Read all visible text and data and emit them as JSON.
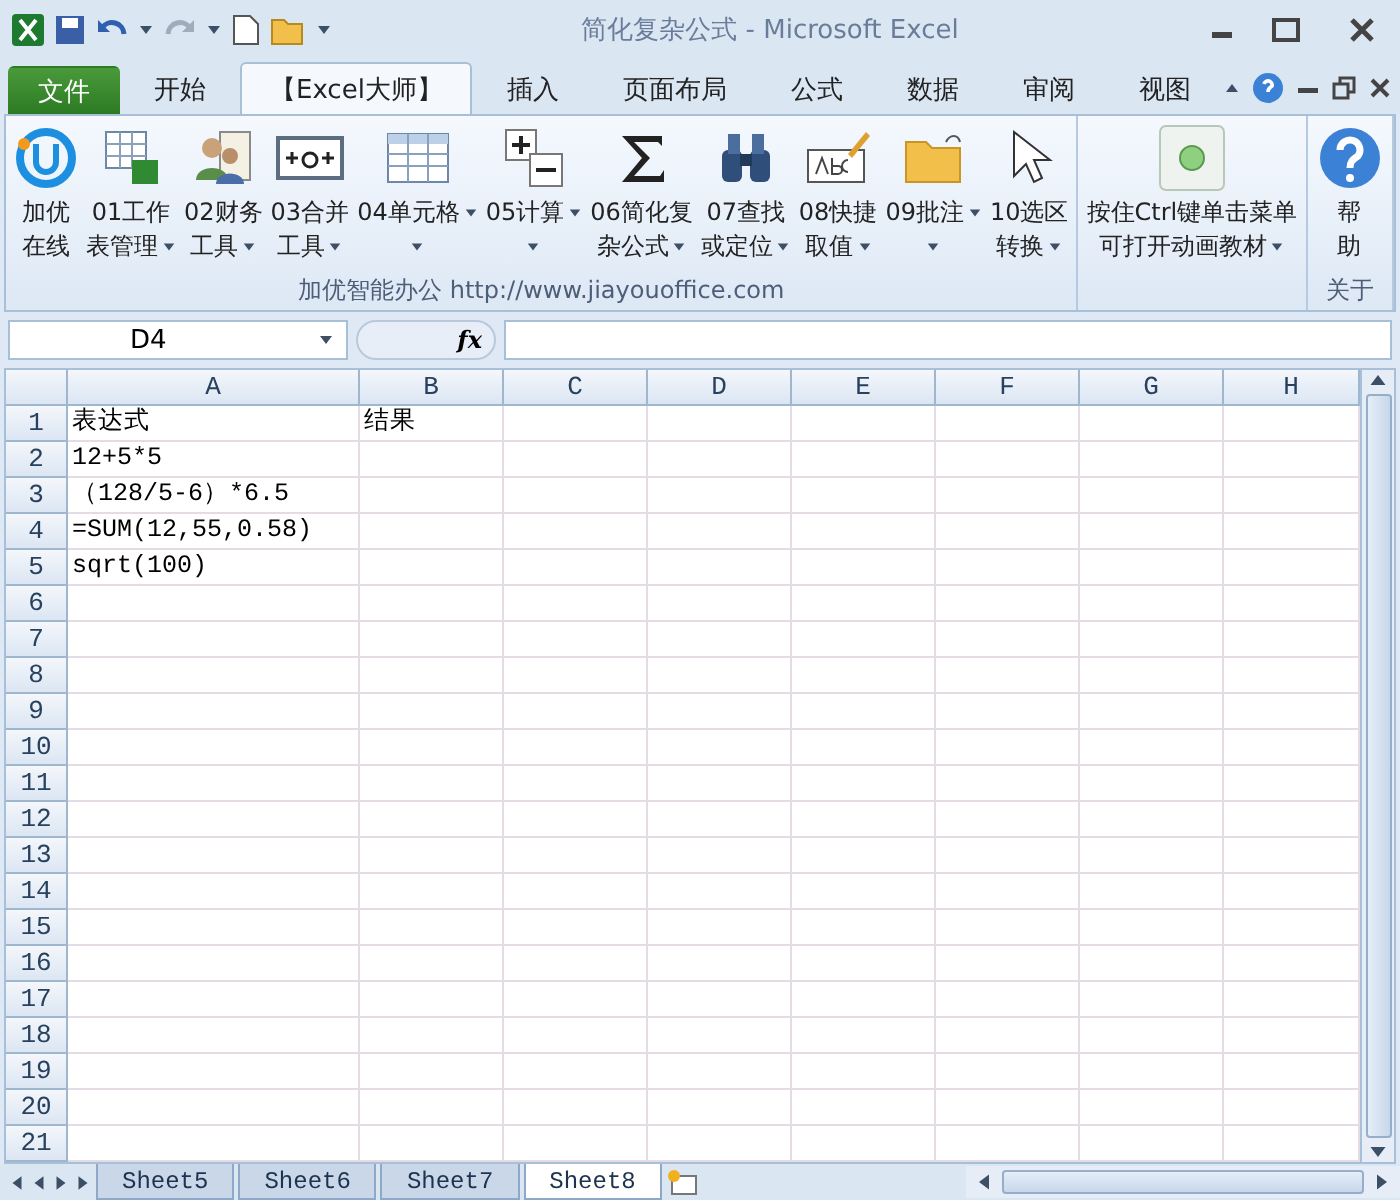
{
  "window": {
    "title": "简化复杂公式 - Microsoft Excel"
  },
  "tabs": [
    {
      "label": "文件",
      "selected": false,
      "kind": "file"
    },
    {
      "label": "开始",
      "selected": false,
      "kind": "tab"
    },
    {
      "label": "【Excel大师】",
      "selected": true,
      "kind": "tab"
    },
    {
      "label": "插入",
      "selected": false,
      "kind": "tab"
    },
    {
      "label": "页面布局",
      "selected": false,
      "kind": "tab"
    },
    {
      "label": "公式",
      "selected": false,
      "kind": "tab"
    },
    {
      "label": "数据",
      "selected": false,
      "kind": "tab"
    },
    {
      "label": "审阅",
      "selected": false,
      "kind": "tab"
    },
    {
      "label": "视图",
      "selected": false,
      "kind": "tab"
    }
  ],
  "ribbon": {
    "groups": [
      {
        "label": "加优智能办公  http://www.jiayouoffice.com",
        "buttons": [
          {
            "lines": [
              "加优",
              "在线"
            ],
            "dropdown": false
          },
          {
            "lines": [
              "01工作",
              "表管理"
            ],
            "dropdown": true
          },
          {
            "lines": [
              "02财务",
              "工具"
            ],
            "dropdown": true
          },
          {
            "lines": [
              "03合并",
              "工具"
            ],
            "dropdown": true
          },
          {
            "lines": [
              "04单元格"
            ],
            "dropdown": true
          },
          {
            "lines": [
              "05计算"
            ],
            "dropdown": true
          },
          {
            "lines": [
              "06简化复",
              "杂公式"
            ],
            "dropdown": true
          },
          {
            "lines": [
              "07查找",
              "或定位"
            ],
            "dropdown": true
          },
          {
            "lines": [
              "08快捷",
              "取值"
            ],
            "dropdown": true
          },
          {
            "lines": [
              "09批注"
            ],
            "dropdown": true
          },
          {
            "lines": [
              "10选区",
              "转换"
            ],
            "dropdown": true
          }
        ]
      },
      {
        "buttons": [
          {
            "lines": [
              "按住Ctrl键单击菜单",
              "可打开动画教材"
            ],
            "dropdown": true
          }
        ]
      },
      {
        "label": "关于",
        "buttons": [
          {
            "lines": [
              "帮",
              "助"
            ],
            "dropdown": false
          }
        ]
      }
    ]
  },
  "name_box": {
    "value": "D4"
  },
  "formula_bar": {
    "label": "fx"
  },
  "columns": [
    "A",
    "B",
    "C",
    "D",
    "E",
    "F",
    "G",
    "H"
  ],
  "rows": [
    {
      "number": "1",
      "cells": [
        "表达式",
        "结果"
      ]
    },
    {
      "number": "2",
      "cells": [
        "12+5*5"
      ]
    },
    {
      "number": "3",
      "cells": [
        "（128/5-6）*6.5"
      ]
    },
    {
      "number": "4",
      "cells": [
        "=SUM(12,55,0.58)"
      ]
    },
    {
      "number": "5",
      "cells": [
        "sqrt(100)"
      ]
    },
    {
      "number": "6",
      "cells": []
    },
    {
      "number": "7",
      "cells": []
    },
    {
      "number": "8",
      "cells": []
    },
    {
      "number": "9",
      "cells": []
    },
    {
      "number": "10",
      "cells": []
    },
    {
      "number": "11",
      "cells": []
    },
    {
      "number": "12",
      "cells": []
    },
    {
      "number": "13",
      "cells": []
    },
    {
      "number": "14",
      "cells": []
    },
    {
      "number": "15",
      "cells": []
    },
    {
      "number": "16",
      "cells": []
    },
    {
      "number": "17",
      "cells": []
    },
    {
      "number": "18",
      "cells": []
    },
    {
      "number": "19",
      "cells": []
    },
    {
      "number": "20",
      "cells": []
    },
    {
      "number": "21",
      "cells": []
    }
  ],
  "sheets": [
    {
      "label": "Sheet5",
      "selected": false
    },
    {
      "label": "Sheet6",
      "selected": false
    },
    {
      "label": "Sheet7",
      "selected": false
    },
    {
      "label": "Sheet8",
      "selected": true
    }
  ]
}
